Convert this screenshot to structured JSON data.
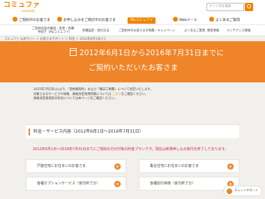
{
  "brand": {
    "name": "コミュファ",
    "sub": "commufa"
  },
  "search": {
    "placeholder": "サイト内を検索"
  },
  "topnav": [
    "ご契約中のお客さま",
    "お申し込みをご検討中のお客さま",
    "Myコミュファ",
    "Webメール",
    "よくあるご質問"
  ],
  "subnav": [
    {
      "line1": "ご契約内容の確認・変更・各種",
      "line2": "手続き（Myコミュファ）"
    },
    {
      "line1": "各種設定・受付方法",
      "line2": ""
    },
    {
      "line1": "ご契約中のお客さまの特典・キャンペーン",
      "line2": ""
    },
    {
      "line1": "よくあるご質問",
      "line2": ""
    },
    {
      "line1": "障害情報",
      "line2": ""
    },
    {
      "line1": "メンテナンス情報",
      "line2": ""
    }
  ],
  "breadcrumb": "コミュファ 公式サイト ＞ お客さまサポート ＞ 料金 ＞ 2012年6月1日から",
  "hero": {
    "line1": "2012年6月1日から2016年7月31日までに",
    "line2": "ご契約いただいたお客さま"
  },
  "intro": {
    "l1": "2025年7月1日(火)より、『契約解除料』および『撤去工事費』について改定いたします。",
    "l2a": "対象となるサービスや価格、価格改定適用時期については",
    "l2link": "こちら",
    "l2b": "をご確認ください。",
    "l3": "価格改定適用前の料金については本ページをご確認ください。"
  },
  "section_title": "料金・サービス内容（2012年6月1日～2016年7月31日）",
  "notice": "2012年6月1日～2016年7月31日までにご契約の方が対象の料金プランです。現在は新規申し込み受付を終了しております。",
  "cards": [
    {
      "label": "戸建住宅にお住まいのお客さま"
    },
    {
      "label": "集合住宅にお住まいのお客さま"
    },
    {
      "label": "各種オプションサービス（受付終了分）"
    },
    {
      "label": "各種割引特典（受付終了分）"
    }
  ],
  "chat": {
    "label": "チャットサポート"
  },
  "colors": {
    "accent": "#ef8428",
    "notice": "#d4233b",
    "background": "#f2f0ec"
  }
}
